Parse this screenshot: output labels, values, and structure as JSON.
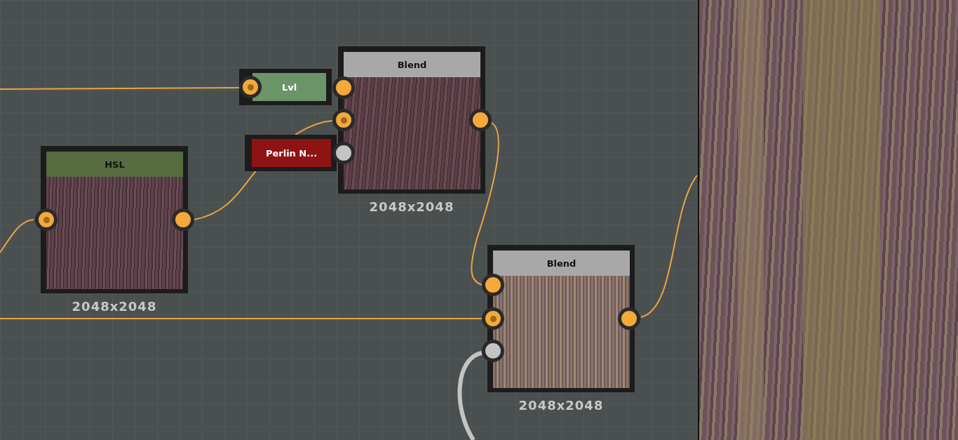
{
  "nodes": [
    {
      "kind": "small",
      "title": "Lvl",
      "color": "#6b9468",
      "ports": [
        {
          "color": "#f5a93a",
          "dot": true
        }
      ]
    },
    {
      "kind": "small",
      "title": "Perlin N...",
      "color": "#8e1414"
    },
    {
      "kind": "preview",
      "title": "Blend",
      "color": "#a8a8a8",
      "resolution": "2048x2048",
      "ports": [
        {
          "color": "#f5a93a",
          "dot": false
        },
        {
          "color": "#f5a93a",
          "dot": true
        },
        {
          "color": "#c4c4c4",
          "dot": false
        },
        {
          "color": "#f5a93a",
          "dot": false
        }
      ]
    },
    {
      "kind": "preview",
      "title": "HSL",
      "color": "#566b40",
      "resolution": "2048x2048",
      "ports": [
        {
          "color": "#f5a93a",
          "dot": true
        },
        {
          "color": "#f5a93a",
          "dot": false
        }
      ]
    },
    {
      "kind": "preview",
      "title": "Blend",
      "color": "#a8a8a8",
      "resolution": "2048x2048",
      "ports": [
        {
          "color": "#f5a93a",
          "dot": false
        },
        {
          "color": "#f5a93a",
          "dot": true
        },
        {
          "color": "#c4c4c4",
          "dot": false
        },
        {
          "color": "#f5a93a",
          "dot": false
        }
      ]
    }
  ]
}
